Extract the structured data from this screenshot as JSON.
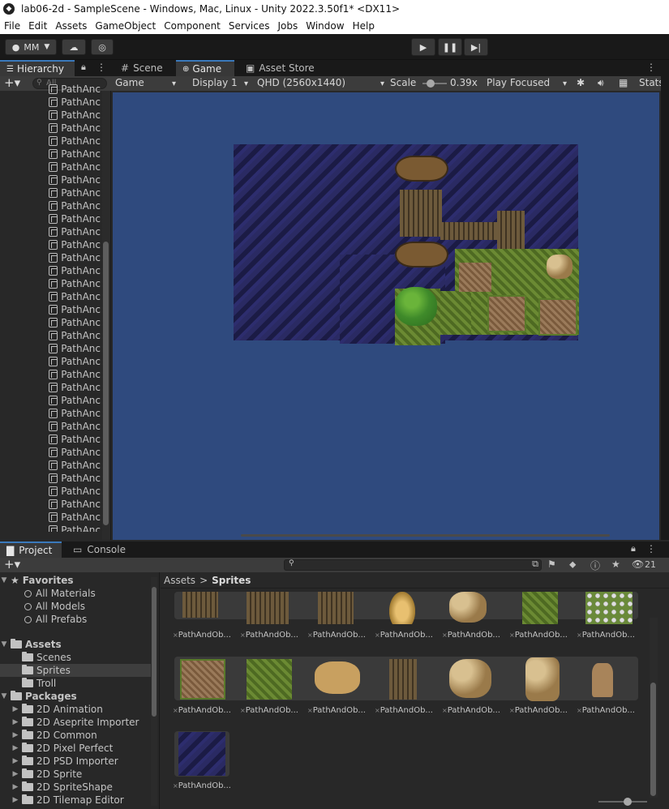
{
  "window": {
    "title": "lab06-2d - SampleScene - Windows, Mac, Linux - Unity 2022.3.50f1* <DX11>"
  },
  "menu": [
    "File",
    "Edit",
    "Assets",
    "GameObject",
    "Component",
    "Services",
    "Jobs",
    "Window",
    "Help"
  ],
  "toolbar": {
    "account": "MM"
  },
  "hierarchy": {
    "tab_label": "Hierarchy",
    "search_placeholder": "All",
    "items": [
      "PathAnc",
      "PathAnc",
      "PathAnc",
      "PathAnc",
      "PathAnc",
      "PathAnc",
      "PathAnc",
      "PathAnc",
      "PathAnc",
      "PathAnc",
      "PathAnc",
      "PathAnc",
      "PathAnc",
      "PathAnc",
      "PathAnc",
      "PathAnc",
      "PathAnc",
      "PathAnc",
      "PathAnc",
      "PathAnc",
      "PathAnc",
      "PathAnc",
      "PathAnc",
      "PathAnc",
      "PathAnc",
      "PathAnc",
      "PathAnc",
      "PathAnc",
      "PathAnc",
      "PathAnc",
      "PathAnc",
      "PathAnc",
      "PathAnc",
      "PathAnc",
      "PathAnc"
    ]
  },
  "gameview": {
    "tabs": [
      "Scene",
      "Game",
      "Asset Store"
    ],
    "mode": "Game",
    "display": "Display 1",
    "resolution": "QHD (2560x1440)",
    "scale_label": "Scale",
    "scale_value": "0.39x",
    "play_mode": "Play Focused",
    "stats": "Stats",
    "slider_fraction": 0.05
  },
  "project": {
    "tabs": [
      "Project",
      "Console"
    ],
    "search_placeholder": "",
    "count": "21",
    "favorites_label": "Favorites",
    "favorites": [
      "All Materials",
      "All Models",
      "All Prefabs"
    ],
    "assets_label": "Assets",
    "asset_folders": [
      "Scenes",
      "Sprites",
      "Troll"
    ],
    "packages_label": "Packages",
    "packages": [
      "2D Animation",
      "2D Aseprite Importer",
      "2D Common",
      "2D Pixel Perfect",
      "2D PSD Importer",
      "2D Sprite",
      "2D SpriteShape",
      "2D Tilemap Editor"
    ],
    "breadcrumb": [
      "Assets",
      "Sprites"
    ],
    "row1_labels": [
      "PathAndOb...",
      "PathAndOb...",
      "PathAndOb...",
      "PathAndOb...",
      "PathAndOb...",
      "PathAndOb...",
      "PathAndOb..."
    ],
    "row2_labels": [
      "PathAndOb...",
      "PathAndOb...",
      "PathAndOb...",
      "PathAndOb...",
      "PathAndOb...",
      "PathAndOb...",
      "PathAndOb..."
    ],
    "row3_labels": [
      "PathAndOb..."
    ]
  },
  "colors": {
    "accent": "#3a79bb",
    "game_bg": "#2f4a7e",
    "panel": "#282828"
  }
}
